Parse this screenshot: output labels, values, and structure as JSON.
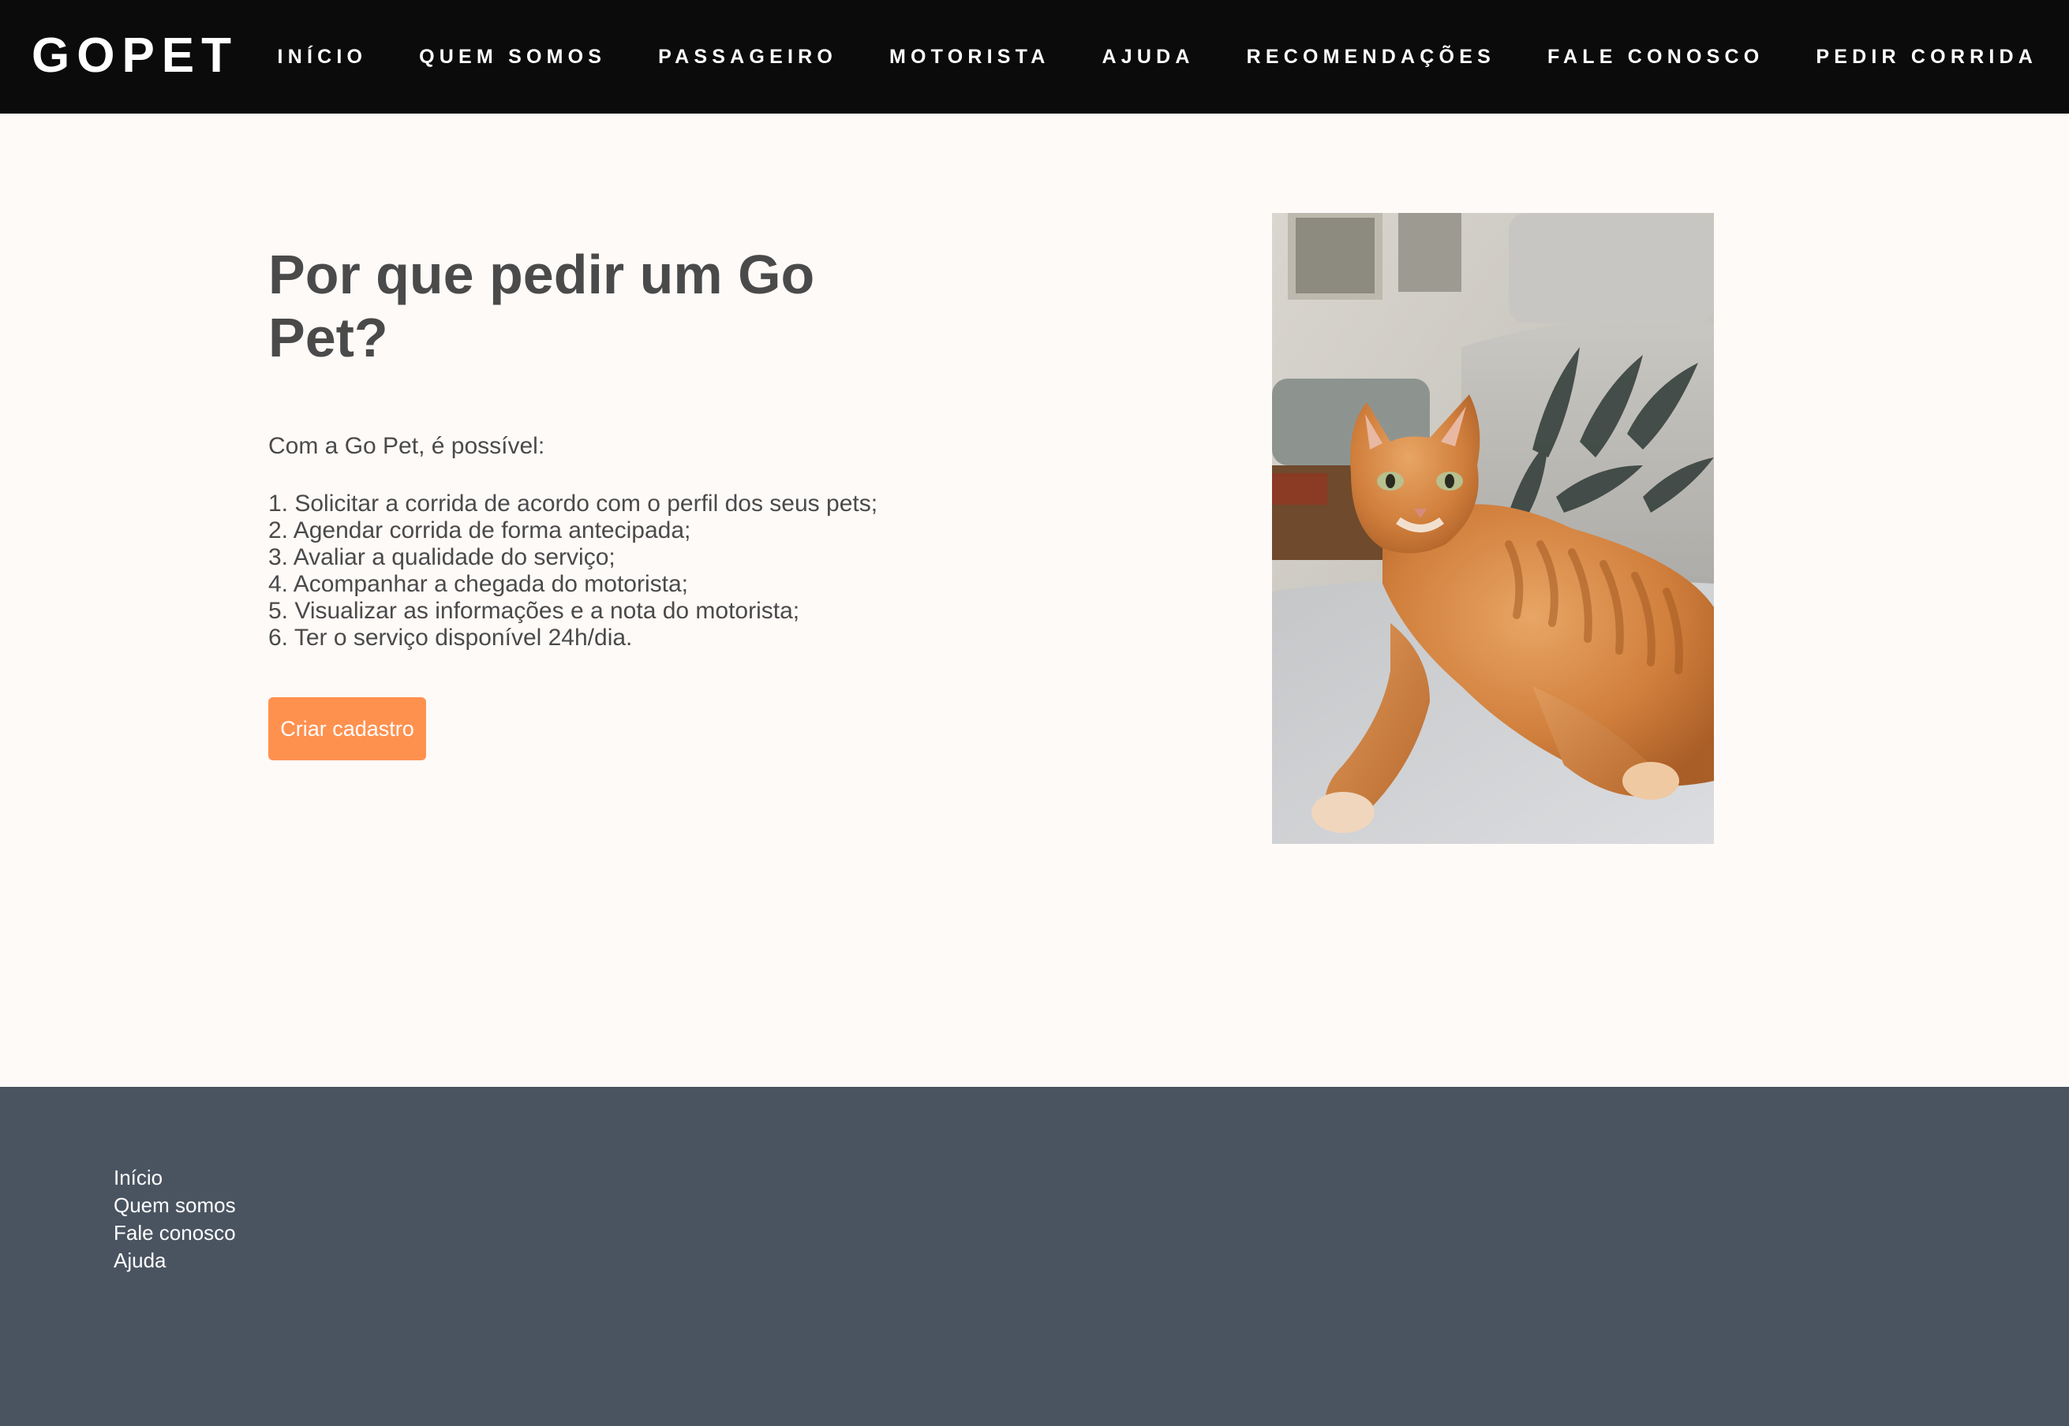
{
  "header": {
    "brand": "GOPET",
    "nav": [
      {
        "label": "INÍCIO"
      },
      {
        "label": "QUEM SOMOS"
      },
      {
        "label": "PASSAGEIRO"
      },
      {
        "label": "MOTORISTA"
      },
      {
        "label": "AJUDA"
      },
      {
        "label": "RECOMENDAÇÕES"
      },
      {
        "label": "FALE CONOSCO"
      },
      {
        "label": "PEDIR CORRIDA"
      }
    ]
  },
  "hero": {
    "title": "Por que pedir um Go Pet?",
    "intro": "Com a Go Pet, é possível:",
    "items": [
      "1. Solicitar a corrida de acordo com o perfil dos seus pets;",
      "2. Agendar corrida de forma antecipada;",
      "3. Avaliar a qualidade do serviço;",
      "4. Acompanhar a chegada do motorista;",
      "5. Visualizar as informações e a nota do motorista;",
      "6. Ter o serviço disponível 24h/dia."
    ],
    "cta_label": "Criar cadastro"
  },
  "footer": {
    "links": [
      {
        "label": "Início"
      },
      {
        "label": "Quem somos"
      },
      {
        "label": "Fale conosco"
      },
      {
        "label": "Ajuda"
      }
    ]
  },
  "colors": {
    "nav_background": "#0b0b0b",
    "page_background": "#fefaf8",
    "text": "#4a4a4a",
    "cta": "#ff914f",
    "footer_background": "#4a5461"
  }
}
